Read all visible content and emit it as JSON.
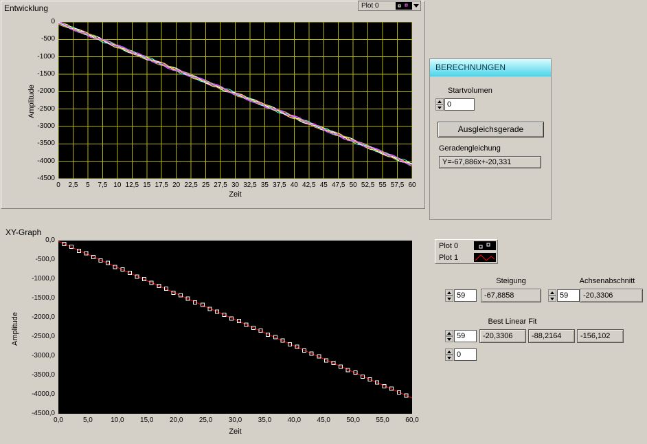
{
  "top_graph": {
    "title": "Entwicklung",
    "plot_selector_label": "Plot 0",
    "xlabel": "Zeit",
    "ylabel": "Amplitude"
  },
  "berechnungen": {
    "header": "BERECHNUNGEN",
    "startvolumen_label": "Startvolumen",
    "startvolumen_value": "0",
    "button_label": "Ausgleichsgerade",
    "gerade_label": "Geradengleichung",
    "gerade_value": "Y=-67,886x+-20,331"
  },
  "xy_graph": {
    "title": "XY-Graph",
    "xlabel": "Zeit",
    "ylabel": "Amplitude",
    "legend": [
      {
        "label": "Plot 0"
      },
      {
        "label": "Plot 1"
      }
    ]
  },
  "controls": {
    "steigung_label": "Steigung",
    "steigung_index": "59",
    "steigung_value": "-67,8858",
    "achsenabschnitt_label": "Achsenabschnitt",
    "achsenabschnitt_index": "59",
    "achsenabschnitt_value": "-20,3306",
    "best_linear_fit_label": "Best Linear Fit",
    "best_linear_fit_index": "59",
    "best_linear_fit_values": [
      "-20,3306",
      "-88,2164",
      "-156,102"
    ],
    "second_index": "0"
  },
  "colors": {
    "panel_bg": "#d4d0c8",
    "plot_bg": "#000000",
    "grid": "#b7b700",
    "header_gradient_top": "#d8fcff",
    "header_gradient_bottom": "#4cd4ea",
    "header_text": "#083c4c",
    "fit_line": "#ff0000",
    "marker": "#ffffff"
  },
  "chart_data": [
    {
      "type": "line",
      "title": "Entwicklung",
      "xlabel": "Zeit",
      "ylabel": "Amplitude",
      "xlim": [
        0,
        60
      ],
      "ylim": [
        -4500,
        0
      ],
      "grid": true,
      "legend_position": "top-right",
      "x_tick_labels": [
        "0",
        "2,5",
        "5",
        "7,5",
        "10",
        "12,5",
        "15",
        "17,5",
        "20",
        "22,5",
        "25",
        "27,5",
        "30",
        "32,5",
        "35",
        "37,5",
        "40",
        "42,5",
        "45",
        "47,5",
        "50",
        "52,5",
        "55",
        "57,5",
        "60"
      ],
      "y_tick_labels": [
        "0",
        "-500",
        "-1000",
        "-1500",
        "-2000",
        "-2500",
        "-3000",
        "-3500",
        "-4000",
        "-4500"
      ],
      "fit": {
        "slope": -67.886,
        "intercept": -20.331
      },
      "series_note": "many overlapping multicolored measurement traces following the fit line from (0,0) down to (60,-4100)",
      "trace_colors": [
        "#ff5050",
        "#50ff50",
        "#5078ff",
        "#ff50ff",
        "#50ffff",
        "#ffff60",
        "#ffffff",
        "#ff9040",
        "#c060ff"
      ]
    },
    {
      "type": "scatter",
      "title": "XY-Graph",
      "xlabel": "Zeit",
      "ylabel": "Amplitude",
      "xlim": [
        0,
        60
      ],
      "ylim": [
        -4500,
        0
      ],
      "grid": false,
      "x_tick_labels": [
        "0,0",
        "5,0",
        "10,0",
        "15,0",
        "20,0",
        "25,0",
        "30,0",
        "35,0",
        "40,0",
        "45,0",
        "50,0",
        "55,0",
        "60,0"
      ],
      "y_tick_labels": [
        "0,0",
        "-500,0",
        "-1000,0",
        "-1500,0",
        "-2000,0",
        "-2500,0",
        "-3000,0",
        "-3500,0",
        "-4000,0",
        "-4500,0"
      ],
      "series": [
        {
          "name": "Plot 0",
          "style": "marker-square",
          "color": "#ffffff"
        },
        {
          "name": "Plot 1",
          "style": "line",
          "color": "#ff0000"
        }
      ],
      "fit": {
        "slope": -67.8858,
        "intercept": -20.3306
      },
      "n_points": 48,
      "x_start": 1,
      "x_end": 59
    }
  ]
}
